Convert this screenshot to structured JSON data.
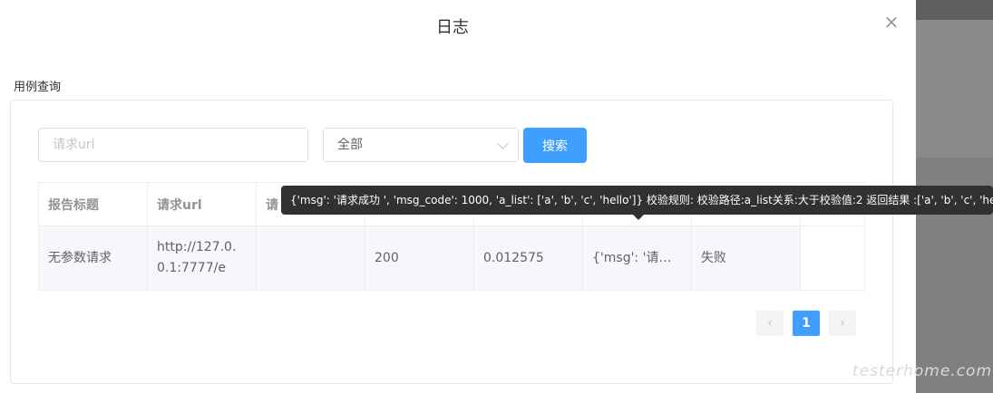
{
  "dialog": {
    "title": "日志",
    "close_icon": "×"
  },
  "section": {
    "label": "用例查询"
  },
  "search": {
    "placeholder": "请求url",
    "value": ""
  },
  "filter": {
    "selected": "全部"
  },
  "search_button": {
    "label": "搜索"
  },
  "table": {
    "headers": [
      "报告标题",
      "请求url",
      "请",
      "",
      "",
      "",
      "",
      ""
    ],
    "rows": [
      {
        "title": "无参数请求",
        "url": "http://127.0.0.1:7777/e",
        "params": "",
        "status_code": "200",
        "time": "0.012575",
        "response": "{'msg': '请求…",
        "result": "失败"
      }
    ]
  },
  "tooltip": {
    "text": "{'msg': '请求成功 ', 'msg_code': 1000, 'a_list': ['a', 'b', 'c', 'hello']} 校验规则: 校验路径:a_list关系:大于校验值:2 返回结果 :['a', 'b', 'c', 'hello'] 不是数字"
  },
  "pagination": {
    "prev": "‹",
    "current": "1",
    "next": "›"
  },
  "watermark": "testerhome.com",
  "colors": {
    "primary": "#409eff",
    "danger": "#f56c6c",
    "tooltip_bg": "#303133"
  }
}
